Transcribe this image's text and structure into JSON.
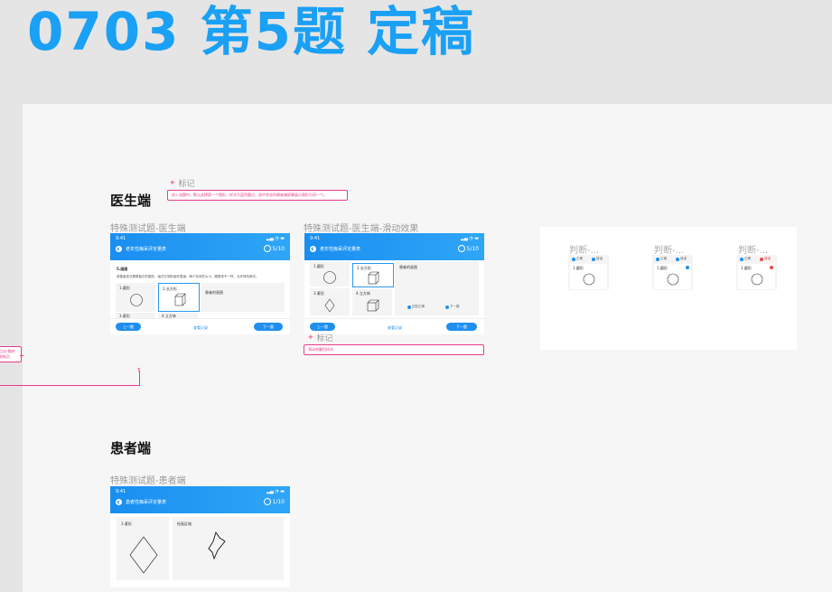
{
  "page_title": "0703  第5题  定稿",
  "doctor_section": {
    "label": "医生端",
    "note_tag": "标记",
    "note_text": "进入该题时，默认选择第一个图形，样式为蓝色题边，选中状态同患者端屏幕展示图形为同一个。",
    "frame1": {
      "label": "特殊测试题-医生端",
      "status_time": "9:41",
      "nav_title": "老年性痴呆评定量表",
      "progress": "5/10",
      "question_title": "5.画图",
      "question_desc": "请患者依次看屏幕中的图形，画在左侧的画布里面，两个形状的大小、跟原来不一样，允许修改两次。",
      "item1": "1.圆形",
      "item2": "2.长方形",
      "item3": "患者的画图",
      "item4": "3.菱形",
      "item5": "4.立方体",
      "prev": "上一题",
      "mid": "查看记录",
      "next": "下一题"
    },
    "frame2": {
      "label": "特殊测试题-医生端-滑动效果",
      "status_time": "9:41",
      "nav_title": "老年性痴呆评定量表",
      "progress": "5/10",
      "item1": "1.圆形",
      "item2": "2.长方形",
      "item3": "患者的画图",
      "item4": "3.菱形",
      "item5": "4.立方体",
      "opt1": "回答正确",
      "opt2": "下一题",
      "prev": "上一题",
      "mid": "查看记录",
      "next": "下一题",
      "note_tag": "标记",
      "note_text": "滑动的翻页样式"
    },
    "left_note": "点击-跳转\n到新页"
  },
  "judge_panel": {
    "cards": [
      {
        "title": "判断-...",
        "opt_a": "正确",
        "opt_b": "错误",
        "item": "1.圆形"
      },
      {
        "title": "判断-...",
        "opt_a": "正确",
        "opt_b": "错误",
        "item": "1.圆形"
      },
      {
        "title": "判断-...",
        "opt_a": "正确",
        "opt_b": "错误",
        "item": "1.圆形"
      }
    ]
  },
  "patient_section": {
    "label": "患者端",
    "frame": {
      "label": "特殊测试题-患者端",
      "status_time": "9:41",
      "nav_title": "患者性痴呆评定量表",
      "progress": "1/10",
      "left_title": "3.菱形",
      "right_title": "绘画区域"
    }
  },
  "colors": {
    "title_blue": "#1aa0f5",
    "header_blue": "#1a8ef0",
    "note_pink": "#e83c8d"
  }
}
